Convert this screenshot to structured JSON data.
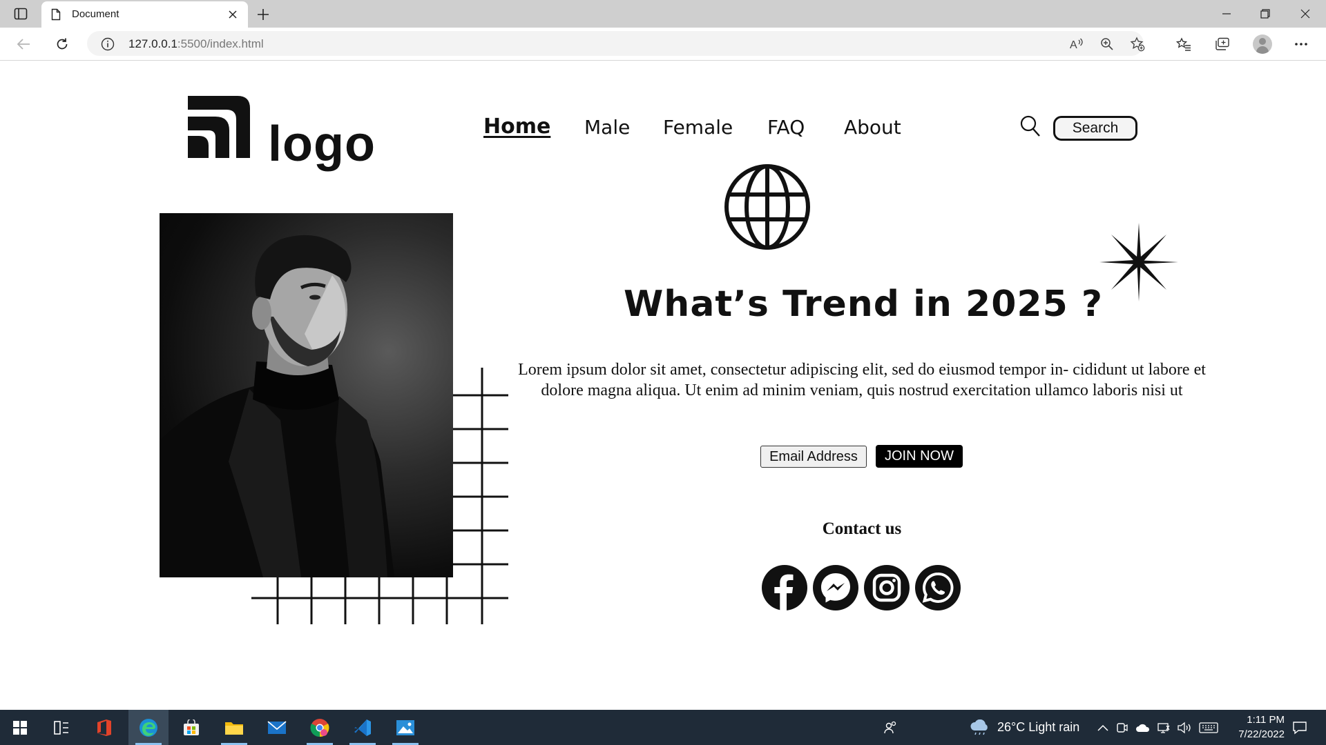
{
  "browser": {
    "tab_title": "Document",
    "url_host": "127.0.0.1",
    "url_path": ":5500/index.html"
  },
  "site": {
    "logo_text": "logo",
    "nav": {
      "home": "Home",
      "male": "Male",
      "female": "Female",
      "faq": "FAQ",
      "about": "About"
    },
    "search_label": "Search",
    "headline": "What’s Trend in 2025 ?",
    "body_text": "Lorem ipsum dolor sit amet, consectetur adipiscing elit, sed do eiusmod tempor in- cididunt ut labore et dolore magna aliqua. Ut enim ad minim veniam, quis nostrud exercitation ullamco laboris nisi ut",
    "email_label": "Email Address",
    "join_label": "JOIN NOW",
    "contact_title": "Contact us",
    "social_icons": [
      "facebook-icon",
      "messenger-icon",
      "instagram-icon",
      "whatsapp-icon"
    ]
  },
  "taskbar": {
    "weather": "26°C  Light rain",
    "time": "1:11 PM",
    "date": "7/22/2022",
    "apps": [
      "start-icon",
      "task-view-icon",
      "office-icon",
      "edge-icon",
      "store-icon",
      "file-explorer-icon",
      "mail-icon",
      "chrome-icon",
      "vscode-icon",
      "photos-icon"
    ]
  },
  "colors": {
    "taskbar_bg": "#1f2b38",
    "tabbar_bg": "#cfcfcf",
    "accent": "#000000"
  }
}
